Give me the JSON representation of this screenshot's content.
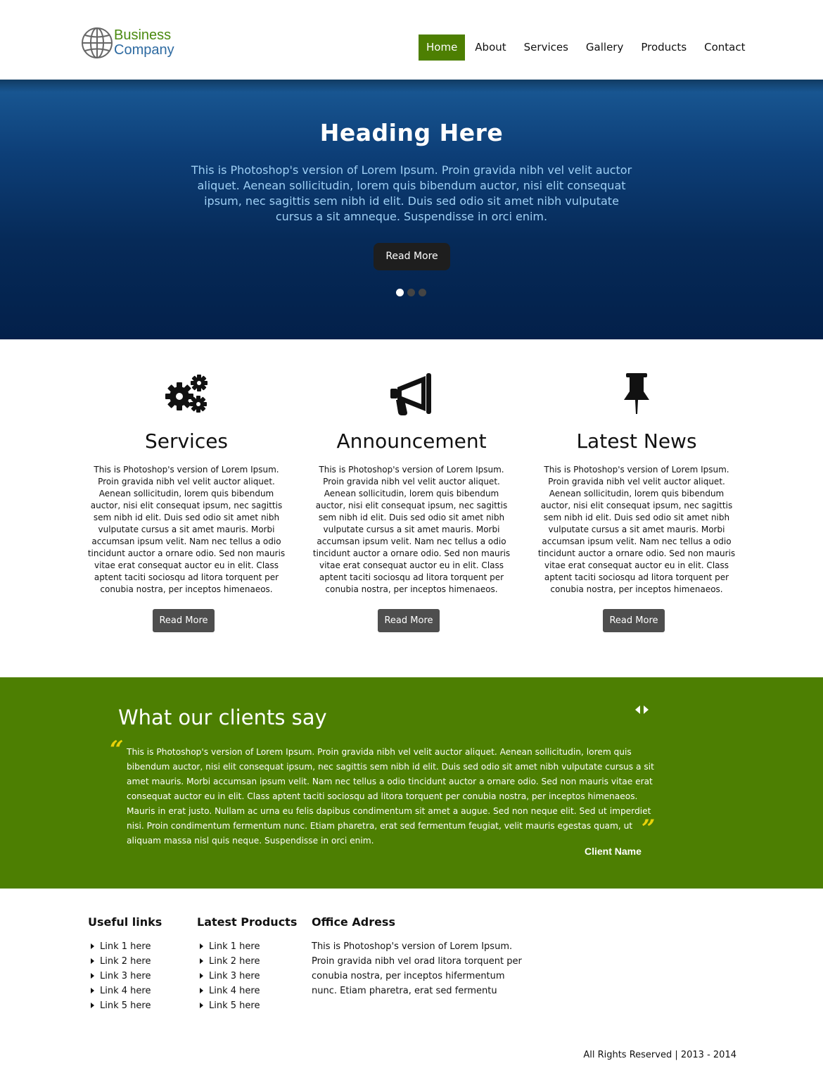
{
  "brand": {
    "line1": "Business",
    "line2": "Company",
    "line1_color": "#4a8a0f",
    "line2_color": "#2d6aa1"
  },
  "nav": {
    "items": [
      "Home",
      "About",
      "Services",
      "Gallery",
      "Products",
      "Contact"
    ],
    "active": "Home",
    "active_color": "#4d7f02"
  },
  "hero": {
    "title": "Heading Here",
    "text": "This is Photoshop's version  of Lorem Ipsum. Proin gravida nibh vel velit auctor aliquet. Aenean sollicitudin, lorem quis bibendum auctor, nisi elit consequat ipsum, nec sagittis sem nibh id elit. Duis sed odio sit amet nibh vulputate cursus a sit amneque. Suspendisse in orci enim.",
    "button": "Read More",
    "slides": 3,
    "active_slide": 1
  },
  "features": [
    {
      "icon": "gears-icon",
      "title": "Services",
      "text": "This is Photoshop's version  of Lorem Ipsum. Proin gravida nibh vel velit auctor aliquet. Aenean sollicitudin, lorem quis bibendum auctor, nisi elit consequat ipsum, nec sagittis sem nibh id elit. Duis sed odio sit amet nibh vulputate cursus a sit amet mauris. Morbi accumsan ipsum velit. Nam nec tellus a odio tincidunt auctor a ornare odio. Sed non  mauris vitae erat consequat auctor eu in elit. Class aptent taciti sociosqu ad litora torquent per conubia nostra, per inceptos himenaeos.",
      "button": "Read More"
    },
    {
      "icon": "megaphone-icon",
      "title": "Announcement",
      "text": "This is Photoshop's version  of Lorem Ipsum. Proin gravida nibh vel velit auctor aliquet. Aenean sollicitudin, lorem quis bibendum auctor, nisi elit consequat ipsum, nec sagittis sem nibh id elit. Duis sed odio sit amet nibh vulputate cursus a sit amet mauris. Morbi accumsan ipsum velit. Nam nec tellus a odio tincidunt auctor a ornare odio. Sed non  mauris vitae erat consequat auctor eu in elit. Class aptent taciti sociosqu ad litora torquent per conubia nostra, per inceptos himenaeos.",
      "button": "Read More"
    },
    {
      "icon": "pushpin-icon",
      "title": "Latest News",
      "text": "This is Photoshop's version  of Lorem Ipsum. Proin gravida nibh vel velit auctor aliquet. Aenean sollicitudin, lorem quis bibendum auctor, nisi elit consequat ipsum, nec sagittis sem nibh id elit. Duis sed odio sit amet nibh vulputate cursus a sit amet mauris. Morbi accumsan ipsum velit. Nam nec tellus a odio tincidunt auctor a ornare odio. Sed non  mauris vitae erat consequat auctor eu in elit. Class aptent taciti sociosqu ad litora torquent per conubia nostra, per inceptos himenaeos.",
      "button": "Read More"
    }
  ],
  "testimonials": {
    "title": "What our clients say",
    "quote": "This is Photoshop's version  of Lorem Ipsum. Proin gravida nibh vel velit auctor aliquet. Aenean sollicitudin, lorem quis bibendum auctor, nisi elit consequat ipsum, nec sagittis sem nibh id elit. Duis sed odio sit amet nibh vulputate cursus a sit amet mauris. Morbi accumsan ipsum velit. Nam nec tellus a odio tincidunt auctor a ornare odio. Sed non  mauris vitae erat consequat auctor eu in elit. Class aptent taciti sociosqu ad litora torquent per conubia nostra, per inceptos himenaeos. Mauris in erat justo. Nullam ac urna eu felis dapibus condimentum sit amet a augue. Sed non neque elit. Sed ut imperdiet nisi. Proin condimentum fermentum nunc. Etiam pharetra, erat sed fermentum feugiat, velit mauris egestas quam, ut aliquam massa nisl quis neque. Suspendisse in orci enim.",
    "client_name": "Client Name",
    "background_color": "#4d7f02",
    "quote_mark_color": "#e8d20a"
  },
  "footer": {
    "useful_links": {
      "title": "Useful links",
      "items": [
        "Link 1 here",
        "Link 2 here",
        "Link 3 here",
        "Link 4 here",
        "Link 5 here"
      ]
    },
    "latest_products": {
      "title": "Latest Products",
      "items": [
        "Link 1 here",
        "Link 2 here",
        "Link 3 here",
        "Link 4 here",
        "Link 5 here"
      ]
    },
    "office": {
      "title": "Office Adress",
      "text": "This is Photoshop's version  of Lorem Ipsum. Proin gravida nibh vel orad litora torquent per conubia nostra, per inceptos hifermentum nunc. Etiam pharetra, erat sed fermentu"
    },
    "copyright": "All Rights Reserved |  2013 - 2014"
  }
}
